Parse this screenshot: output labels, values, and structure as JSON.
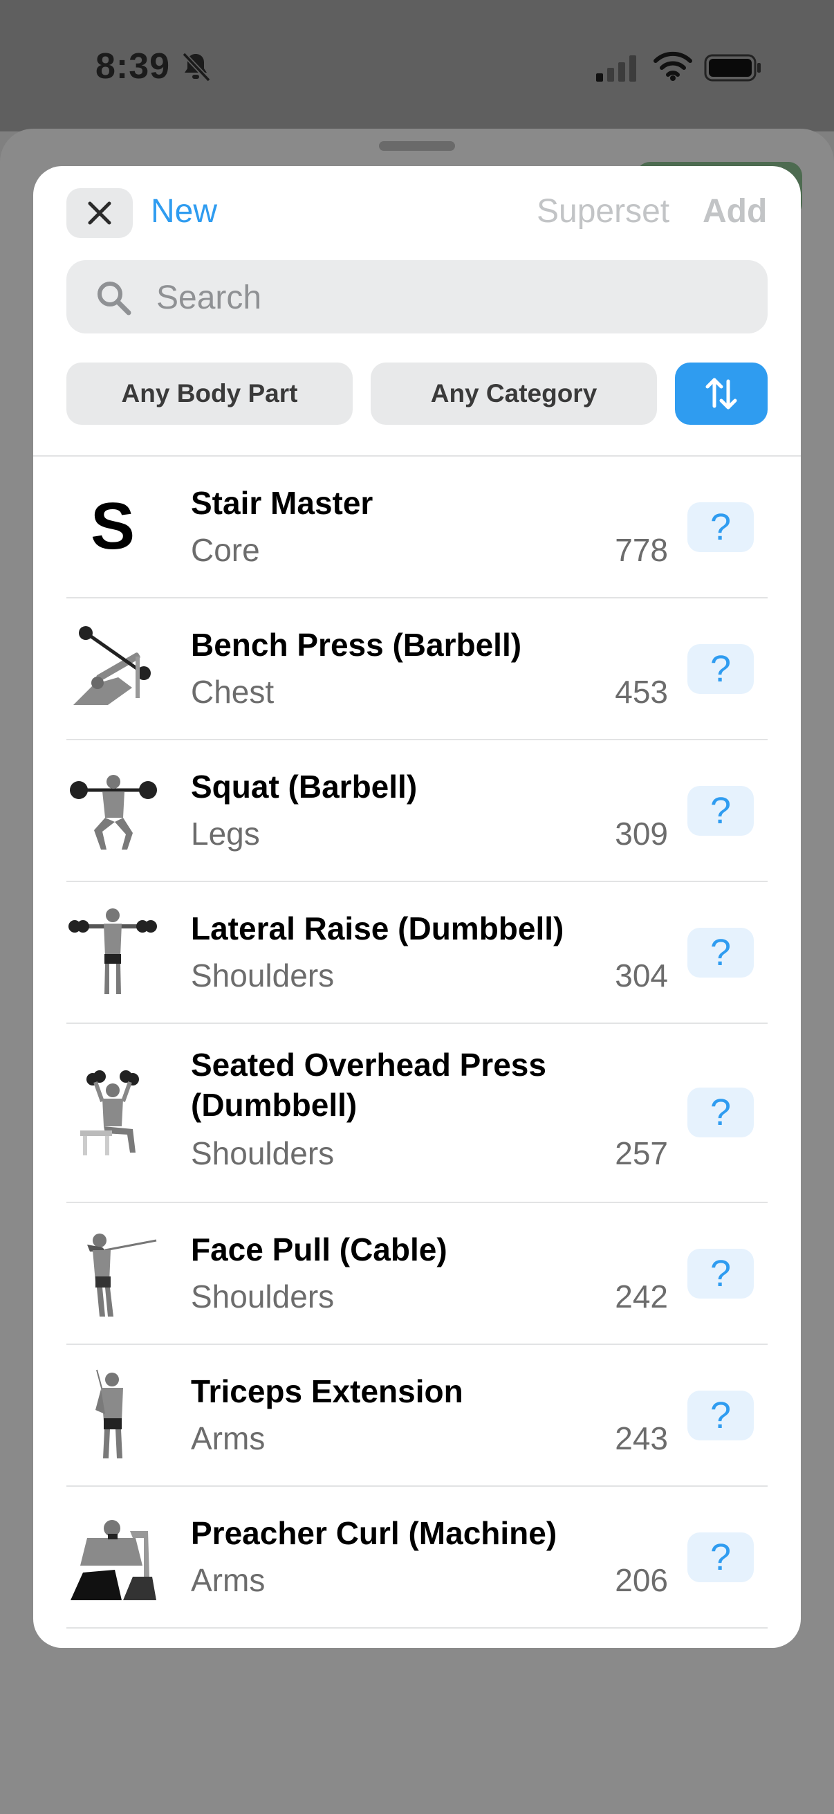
{
  "status_bar": {
    "time": "8:39",
    "icons": [
      "bell-slash-icon",
      "cellular-signal-icon",
      "wifi-icon",
      "battery-icon"
    ]
  },
  "header": {
    "close_icon": "close-icon",
    "new_label": "New",
    "superset_label": "Superset",
    "add_label": "Add"
  },
  "search": {
    "placeholder": "Search",
    "value": ""
  },
  "filters": {
    "body_part_label": "Any Body Part",
    "category_label": "Any Category",
    "sort_icon": "sort-arrows-icon"
  },
  "colors": {
    "accent": "#2f9cf0",
    "disabled_text": "#c2c4c6",
    "secondary_text": "#6c6c6c",
    "chip_bg": "#e8e9ea"
  },
  "exercises": [
    {
      "name": "Stair Master",
      "body_part": "Core",
      "count": "778",
      "thumb": "letter",
      "letter": "S",
      "help": "?"
    },
    {
      "name": "Bench Press (Barbell)",
      "body_part": "Chest",
      "count": "453",
      "thumb": "bench-press-illustration",
      "help": "?"
    },
    {
      "name": "Squat (Barbell)",
      "body_part": "Legs",
      "count": "309",
      "thumb": "squat-illustration",
      "help": "?"
    },
    {
      "name": "Lateral Raise (Dumbbell)",
      "body_part": "Shoulders",
      "count": "304",
      "thumb": "lateral-raise-illustration",
      "help": "?"
    },
    {
      "name": "Seated Overhead Press (Dumbbell)",
      "body_part": "Shoulders",
      "count": "257",
      "thumb": "seated-press-illustration",
      "help": "?"
    },
    {
      "name": "Face Pull (Cable)",
      "body_part": "Shoulders",
      "count": "242",
      "thumb": "face-pull-illustration",
      "help": "?"
    },
    {
      "name": "Triceps Extension",
      "body_part": "Arms",
      "count": "243",
      "thumb": "triceps-extension-illustration",
      "help": "?"
    },
    {
      "name": "Preacher Curl (Machine)",
      "body_part": "Arms",
      "count": "206",
      "thumb": "preacher-curl-illustration",
      "help": "?"
    }
  ]
}
